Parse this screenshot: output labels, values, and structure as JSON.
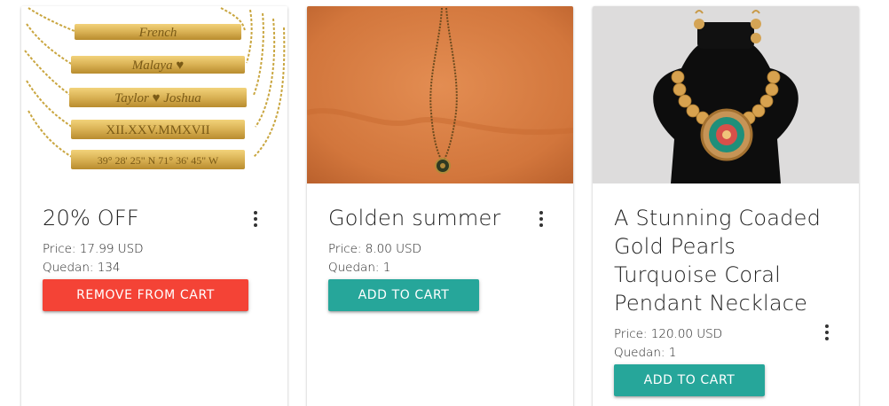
{
  "colors": {
    "remove_button": "#f44336",
    "add_button": "#26a69a",
    "title_text": "#212121"
  },
  "products": [
    {
      "title": "20% OFF",
      "price": "Price: 17.99 USD",
      "stock": "Quedan: 134",
      "button_label": "REMOVE FROM CART",
      "image_engravings": [
        "French",
        "Malaya ♥",
        "Taylor ♥ Joshua",
        "XII.XXV.MMXVII",
        "39° 28' 25\" N 71° 36' 45\" W"
      ]
    },
    {
      "title": "Golden summer",
      "price": "Price: 8.00 USD",
      "stock": "Quedan: 1",
      "button_label": "ADD TO CART"
    },
    {
      "title": "A Stunning Coaded Gold Pearls Turquoise Coral Pendant Necklace",
      "price": "Price: 120.00 USD",
      "stock": "Quedan: 1",
      "button_label": "ADD TO CART"
    }
  ],
  "icons": {
    "card_menu": "more-vert-icon"
  }
}
